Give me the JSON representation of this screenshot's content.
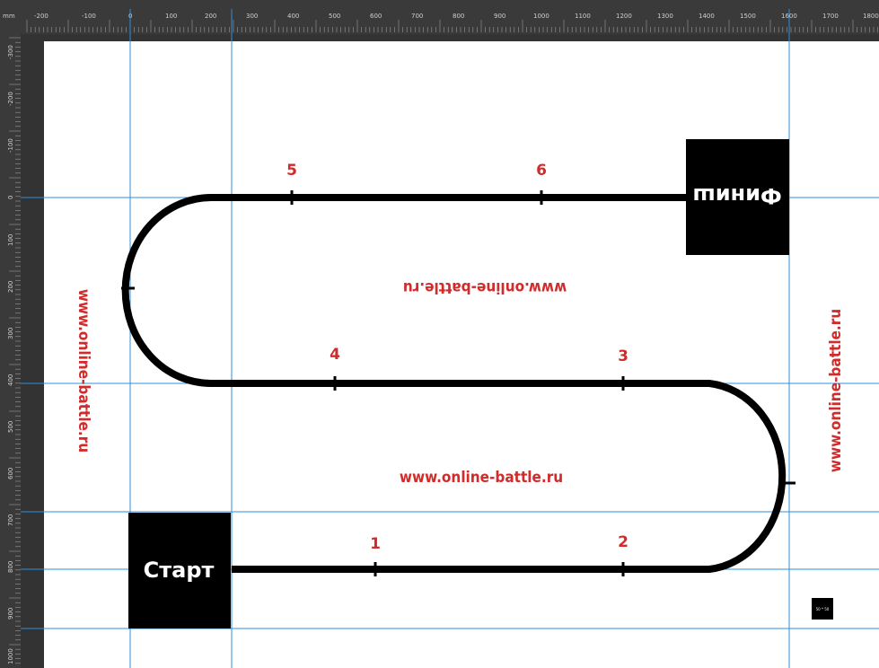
{
  "ruler": {
    "unit": "mm",
    "top_ticks": [
      "-200",
      "-100",
      "0",
      "100",
      "200",
      "300",
      "400",
      "500",
      "600",
      "700",
      "800",
      "900",
      "1000",
      "1100",
      "1200",
      "1300",
      "1400",
      "1500",
      "1600",
      "1700",
      "1800"
    ],
    "left_ticks": [
      "-300",
      "-200",
      "-100",
      "0",
      "100",
      "200",
      "300",
      "400",
      "500",
      "600",
      "700",
      "800",
      "900",
      "1000"
    ]
  },
  "track": {
    "start_label": "Старт",
    "finish_label": "Финиш",
    "checkpoints": [
      "1",
      "2",
      "3",
      "4",
      "5",
      "6"
    ],
    "watermark": "www.online-battle.ru",
    "size_marker": "50 * 50"
  },
  "colors": {
    "track": "#000000",
    "watermark": "#d12b2b",
    "guides": "#2f8fd8",
    "paper": "#ffffff"
  }
}
